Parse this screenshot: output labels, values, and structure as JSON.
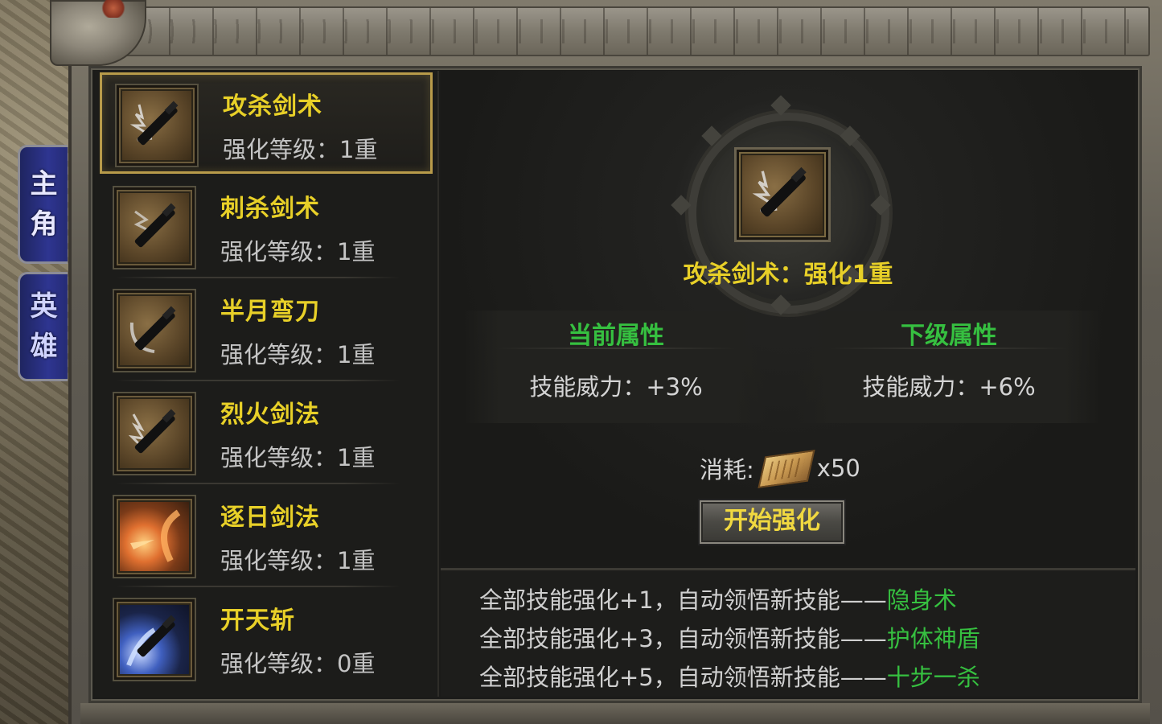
{
  "tabs": [
    {
      "label_1": "主",
      "label_2": "角"
    },
    {
      "label_1": "英",
      "label_2": "雄"
    }
  ],
  "skills": [
    {
      "name": "攻杀剑术",
      "level": "强化等级：1重",
      "icon": "sword-slash-icon",
      "selected": true
    },
    {
      "name": "刺杀剑术",
      "level": "强化等级：1重",
      "icon": "sword-thrust-icon"
    },
    {
      "name": "半月弯刀",
      "level": "强化等级：1重",
      "icon": "half-moon-blade-icon"
    },
    {
      "name": "烈火剑法",
      "level": "强化等级：1重",
      "icon": "flaming-sword-icon"
    },
    {
      "name": "逐日剑法",
      "level": "强化等级：1重",
      "icon": "sun-chasing-fire-icon"
    },
    {
      "name": "开天斩",
      "level": "强化等级：0重",
      "icon": "sky-splitting-blue-icon"
    }
  ],
  "detail": {
    "title": "攻杀剑术：强化1重",
    "current_header": "当前属性",
    "next_header": "下级属性",
    "current_value": "技能威力：+3%",
    "next_value": "技能威力：+6%",
    "cost_label": "消耗:",
    "cost_item_icon": "scroll-icon",
    "cost_count": "x50",
    "start_button": "开始强化"
  },
  "bonuses": [
    {
      "prefix": "全部技能强化+1，自动领悟新技能——",
      "skill": "隐身术"
    },
    {
      "prefix": "全部技能强化+3，自动领悟新技能——",
      "skill": "护体神盾"
    },
    {
      "prefix": "全部技能强化+5，自动领悟新技能——",
      "skill": "十步一杀"
    }
  ],
  "colors": {
    "skill_name": "#e8d028",
    "attr_header": "#36c040",
    "highlight_skill": "#36c040",
    "selected_border": "#b89b4a",
    "tab_blue": "#2e3590"
  }
}
